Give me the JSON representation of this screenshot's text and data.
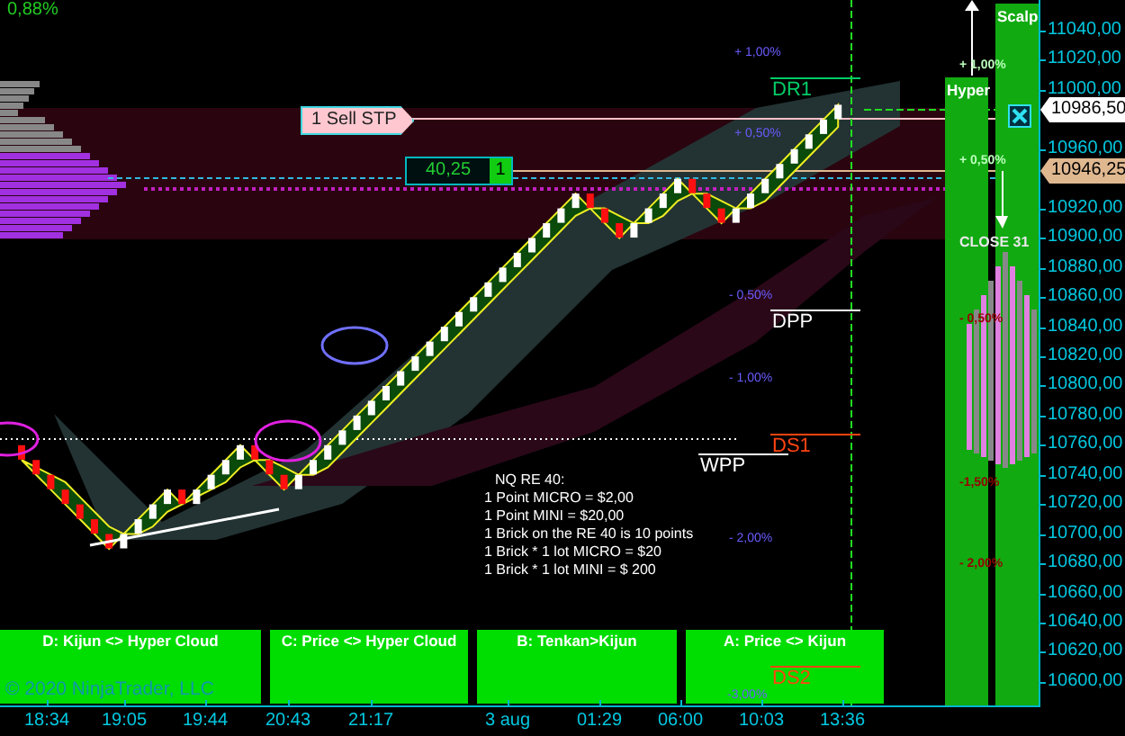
{
  "change_label": "0,88%",
  "order": {
    "label": "1 Sell STP"
  },
  "position": {
    "price": "40,25",
    "qty": "1"
  },
  "levels": [
    {
      "name": "DR1",
      "color": "#00cc66"
    },
    {
      "name": "DPP",
      "color": "#ffffff"
    },
    {
      "name": "DS1",
      "color": "#ff4411"
    },
    {
      "name": "WPP",
      "color": "#ffffff"
    },
    {
      "name": "DS2",
      "color": "#ff4411"
    }
  ],
  "percent_labels": [
    {
      "text": "+ 1,00%",
      "color": "#6a5cff"
    },
    {
      "text": "+ 0,50%",
      "color": "#6a5cff"
    },
    {
      "text": "- 0,50%",
      "color": "#6a5cff"
    },
    {
      "text": "- 1,00%",
      "color": "#6a5cff"
    },
    {
      "text": "- 2,00%",
      "color": "#6a5cff"
    },
    {
      "text": "-3,00%",
      "color": "#6a5cff"
    },
    {
      "text": "+ 1,00%",
      "color": "#bbffbb"
    },
    {
      "text": "+ 0,50%",
      "color": "#bbffbb"
    },
    {
      "text": "- 0,50%",
      "color": "#990000"
    },
    {
      "text": "-1,50%",
      "color": "#990000"
    },
    {
      "text": "- 2,00%",
      "color": "#990000"
    }
  ],
  "close_label": "CLOSE 31",
  "columns": [
    "Hyper",
    "Scalp"
  ],
  "note": [
    "NQ RE 40:",
    "1 Point  MICRO = $2,00",
    "1 Point  MINI     = $20,00",
    "1 Brick on the RE 40 is 10 points",
    "1 Brick * 1 lot MICRO = $20",
    "1 Brick * 1 lot MINI    = $ 200"
  ],
  "panels": [
    "D: Kijun <> Hyper Cloud",
    "C: Price <> Hyper Cloud",
    "B: Tenkan>Kijun",
    "A: Price <> Kijun"
  ],
  "copyright": "© 2020 NinjaTrader, LLC",
  "price_axis": [
    "11040,00",
    "11020,00",
    "11000,00",
    "10960,00",
    "10920,00",
    "10900,00",
    "10880,00",
    "10860,00",
    "10840,00",
    "10820,00",
    "10800,00",
    "10780,00",
    "10760,00",
    "10740,00",
    "10720,00",
    "10700,00",
    "10680,00",
    "10660,00",
    "10640,00",
    "10620,00",
    "10600,00"
  ],
  "price_markers": [
    {
      "text": "10986,50",
      "kind": "last"
    },
    {
      "text": "10946,25",
      "kind": "entry"
    }
  ],
  "time_axis": [
    "18:34",
    "19:05",
    "19:44",
    "20:43",
    "21:17",
    "3 aug",
    "01:29",
    "06:00",
    "10:03",
    "13:36"
  ]
}
